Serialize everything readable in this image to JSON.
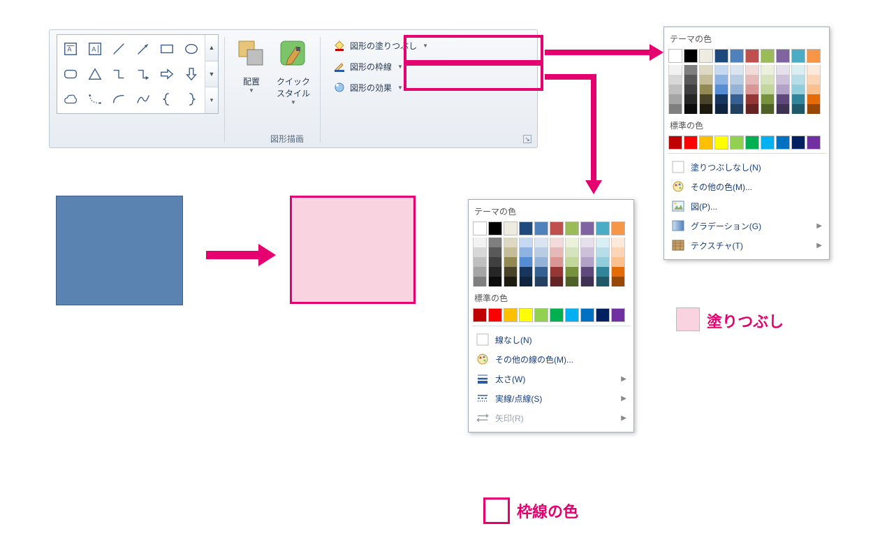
{
  "ribbon": {
    "group_label": "図形描画",
    "arrange_label": "配置",
    "quickstyle_label": "クイック\nスタイル",
    "fill_label": "図形の塗りつぶし",
    "outline_label": "図形の枠線",
    "effects_label": "図形の効果"
  },
  "popup_outline": {
    "theme_title": "テーマの色",
    "standard_title": "標準の色",
    "no_line": "線なし(N)",
    "more_colors": "その他の線の色(M)...",
    "weight": "太さ(W)",
    "dash": "実線/点線(S)",
    "arrows": "矢印(R)"
  },
  "popup_fill": {
    "theme_title": "テーマの色",
    "standard_title": "標準の色",
    "no_fill": "塗りつぶしなし(N)",
    "more_colors": "その他の色(M)...",
    "picture": "図(P)...",
    "gradient": "グラデーション(G)",
    "texture": "テクスチャ(T)"
  },
  "annotations": {
    "fill_label": "塗りつぶし",
    "outline_label": "枠線の色"
  },
  "colors": {
    "theme_main": [
      "#ffffff",
      "#000000",
      "#eeece1",
      "#1f497d",
      "#4f81bd",
      "#c0504d",
      "#9bbb59",
      "#8064a2",
      "#4bacc6",
      "#f79646"
    ],
    "theme_tints": [
      [
        "#f2f2f2",
        "#7f7f7f",
        "#ddd9c3",
        "#c6d9f0",
        "#dbe5f1",
        "#f2dcdb",
        "#ebf1dd",
        "#e5e0ec",
        "#dbeef3",
        "#fdeada"
      ],
      [
        "#d8d8d8",
        "#595959",
        "#c4bd97",
        "#8db3e2",
        "#b8cce4",
        "#e5b9b7",
        "#d7e3bc",
        "#ccc1d9",
        "#b7dde8",
        "#fbd5b5"
      ],
      [
        "#bfbfbf",
        "#3f3f3f",
        "#938953",
        "#548dd4",
        "#95b3d7",
        "#d99694",
        "#c3d69b",
        "#b2a2c7",
        "#92cddc",
        "#fac08f"
      ],
      [
        "#a5a5a5",
        "#262626",
        "#494429",
        "#17365d",
        "#366092",
        "#953734",
        "#76923c",
        "#5f497a",
        "#31859b",
        "#e36c09"
      ],
      [
        "#7f7f7f",
        "#0c0c0c",
        "#1d1b10",
        "#0f243e",
        "#244061",
        "#632423",
        "#4f6128",
        "#3f3151",
        "#205867",
        "#974806"
      ]
    ],
    "standard": [
      "#c00000",
      "#ff0000",
      "#ffc000",
      "#ffff00",
      "#92d050",
      "#00b050",
      "#00b0f0",
      "#0070c0",
      "#002060",
      "#7030a0"
    ]
  }
}
